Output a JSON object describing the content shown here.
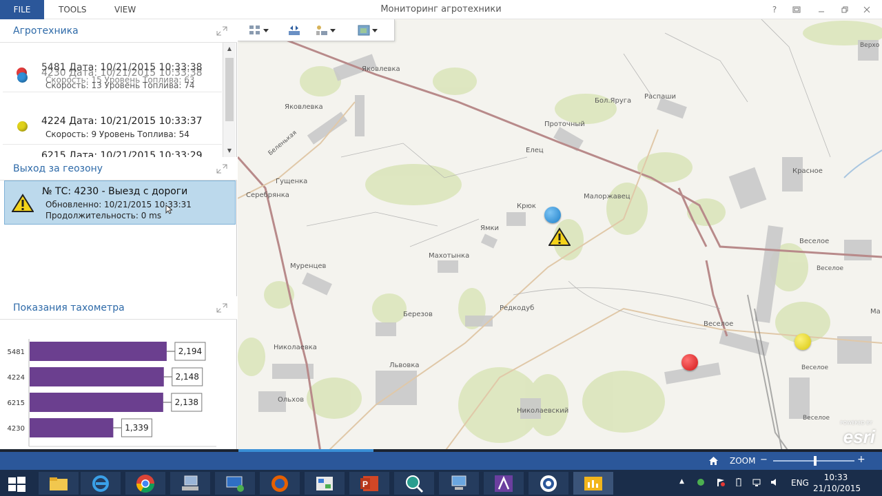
{
  "ribbon": {
    "tabs": [
      "FILE",
      "TOOLS",
      "VIEW"
    ],
    "title": "Мониторинг агротехники",
    "help": "?"
  },
  "sections": {
    "vehicles_title": "Агротехника",
    "geozone_title": "Выход за геозону",
    "tacho_title": "Показания тахометра"
  },
  "vehicles": [
    {
      "main": "5481 Дата: 10/21/2015 10:33:38",
      "sub": "Скорость: 15 Уровень Топлива: 63",
      "color": "#e23b3b"
    },
    {
      "main": "4230 Дата: 10/21/2015 10:33:38",
      "sub": "Скорость: 13 Уровень Топлива: 74",
      "color": "#2f8fd8"
    },
    {
      "main": "4224 Дата: 10/21/2015 10:33:37",
      "sub": "Скорость: 9 Уровень Топлива: 54",
      "color": "#e0d21a"
    },
    {
      "main": "6215 Дата: 10/21/2015 10:33:29",
      "sub": "",
      "color": "#e8a020"
    }
  ],
  "geozone_alert": {
    "title": "№ ТС: 4230 - Выезд с дороги",
    "updated": "Обновленно: 10/21/2015 10:33:31",
    "duration": "Продолжительность: 0 ms"
  },
  "chart_data": {
    "type": "bar",
    "orientation": "horizontal",
    "title": "Показания тахометра",
    "categories": [
      "5481",
      "4224",
      "6215",
      "4230"
    ],
    "values": [
      2194,
      2148,
      2138,
      1339
    ],
    "value_labels": [
      "2,194",
      "2,148",
      "2,138",
      "1,339"
    ],
    "xlim": [
      0,
      3000
    ],
    "xticks": [
      "0",
      "500",
      "1000",
      "1500",
      "2000",
      "2500",
      "3000"
    ],
    "bar_color": "#6b3f8f"
  },
  "map": {
    "labels": [
      "Яковлевка",
      "Яковлевка",
      "Бол.Яруга",
      "Распаши",
      "Проточный",
      "Елец",
      "Беленькая",
      "Гущенка",
      "Серебрянка",
      "Красное",
      "Малоржавец",
      "Крюк",
      "Ямки",
      "Махотынка",
      "Муренцев",
      "Веселое",
      "Веселое",
      "Редкодуб",
      "Березов",
      "Веселое",
      "Николаевка",
      "Львовка",
      "Веселое",
      "Ольхов",
      "Николаевский",
      "Веселое",
      "Верхо",
      "Ма"
    ],
    "esri": "esri",
    "esri_small": "POWERED BY"
  },
  "statusbar": {
    "zoom_label": "ZOOM",
    "zoom_minus": "−",
    "zoom_plus": "+",
    "zoom_level": 0.52
  },
  "taskbar": {
    "lang": "ENG",
    "time": "10:33",
    "date": "21/10/2015"
  },
  "colors": {
    "accent": "#2b579a",
    "section_title": "#2e6aa8",
    "alert_bg": "#bcd9ec"
  }
}
